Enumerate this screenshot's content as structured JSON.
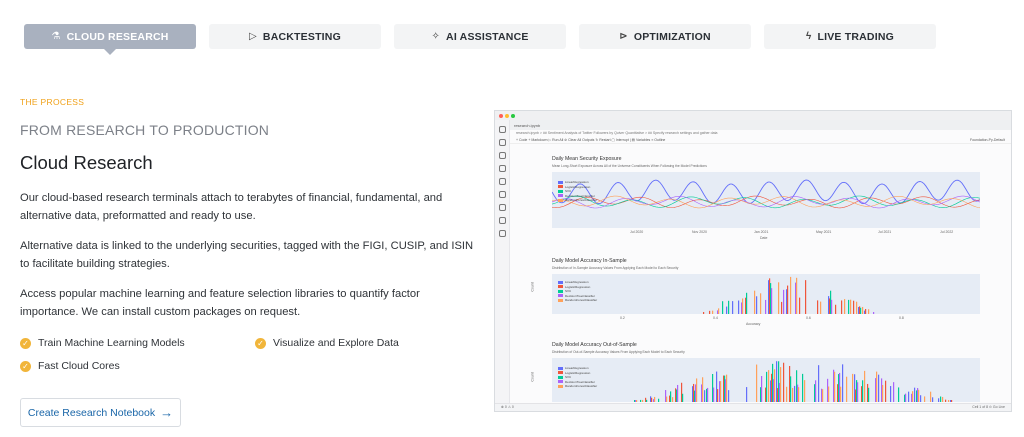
{
  "tabs": [
    {
      "label": "CLOUD RESEARCH",
      "icon": "flask-icon",
      "glyph": "⚗",
      "active": true
    },
    {
      "label": "BACKTESTING",
      "icon": "play-icon",
      "glyph": "▷",
      "active": false
    },
    {
      "label": "AI ASSISTANCE",
      "icon": "sparkle-icon",
      "glyph": "✧",
      "active": false
    },
    {
      "label": "OPTIMIZATION",
      "icon": "fast-forward-icon",
      "glyph": "⊳",
      "active": false
    },
    {
      "label": "LIVE TRADING",
      "icon": "bolt-icon",
      "glyph": "ϟ",
      "active": false
    }
  ],
  "section": {
    "eyebrow": "THE PROCESS",
    "subhead": "FROM RESEARCH TO PRODUCTION",
    "title": "Cloud Research",
    "paragraphs": [
      "Our cloud-based research terminals attach to terabytes of financial, fundamental, and alternative data, preformatted and ready to use.",
      "Alternative data is linked to the underlying securities, tagged with the FIGI, CUSIP, and ISIN to facilitate building strategies.",
      "Access popular machine learning and feature selection libraries to quantify factor importance. We can install custom packages on request."
    ],
    "features": [
      "Train Machine Learning Models",
      "Visualize and Explore Data",
      "Fast Cloud Cores"
    ],
    "cta": "Create Research Notebook",
    "cta_arrow": "→"
  },
  "notebook": {
    "tab": "research.ipynb",
    "breadcrumb": "research.ipynb > ## Sentiment Analysis of Twitter Followers by Quiver Quantitative > ## Specify research settings and gather data",
    "toolbar_left": "+ Code  + Markdown  ▷ Run All  ⊘ Clear All Outputs  ↻ Restart  ▢ Interrupt  | ▤ Variables  ≡ Outline",
    "toolbar_right": "Foundation-Py-Default",
    "charts": [
      {
        "title": "Daily Mean Security Exposure",
        "subtitle": "Mean Long-Short Exposure Across All of the Universe Constituents When Following the Model Predictions",
        "xlabel": "Date"
      },
      {
        "title": "Daily Model Accuracy In-Sample",
        "subtitle": "Distribution of In-Sample Accuracy Values From Applying Each Model to Each Security",
        "xlabel": "Accuracy",
        "ylabel": "Count"
      },
      {
        "title": "Daily Model Accuracy Out-of-Sample",
        "subtitle": "Distribution of Out-of-Sample Accuracy Values From Applying Each Model to Each Security",
        "ylabel": "Count"
      }
    ],
    "legend": [
      "LinearRegression",
      "LogisticRegression",
      "SVC",
      "DecisionTreeClassifier",
      "RandomForestClassifier"
    ],
    "legend_colors": [
      "#636efa",
      "#ef553b",
      "#00cc96",
      "#ab63fa",
      "#ffa15a"
    ],
    "date_ticks": [
      "Jul 2020",
      "Nov 2020",
      "Jan 2021",
      "May 2021",
      "Jul 2021",
      "Jul 2022"
    ],
    "acc_ticks": [
      "0.2",
      "0.4",
      "0.6",
      "0.8"
    ],
    "status_left": "⊗ 0 ⚠ 0",
    "status_right": "Cell 1 of 8  ⊙ Go Live"
  }
}
